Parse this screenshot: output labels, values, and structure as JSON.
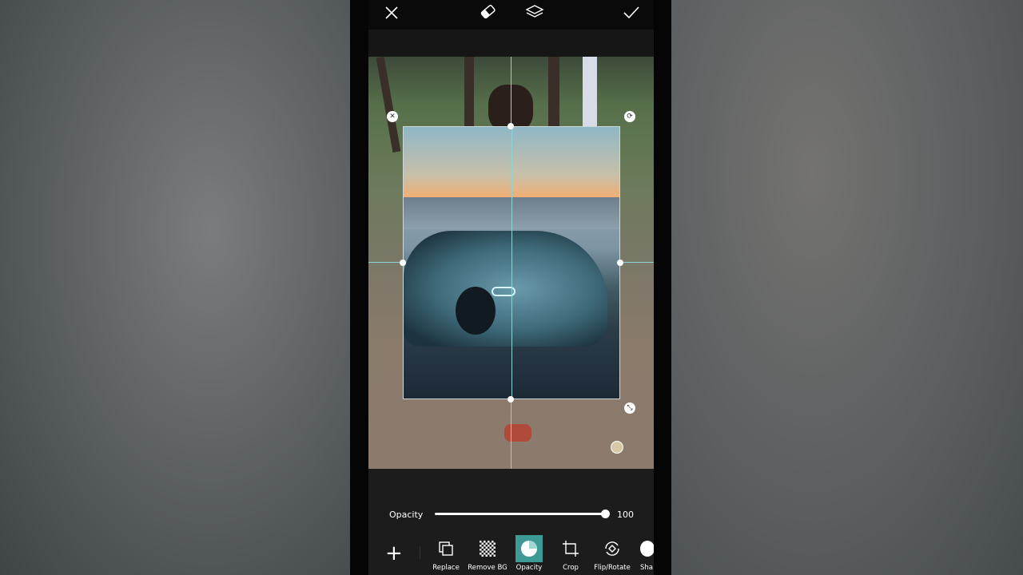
{
  "toolbar": {
    "close": "close-icon",
    "eraser": "eraser-icon",
    "layers": "layers-icon",
    "apply": "check-icon"
  },
  "opacity": {
    "label": "Opacity",
    "value": 100,
    "value_text": "100"
  },
  "tools": [
    {
      "label": "Replace",
      "icon": "replace-icon"
    },
    {
      "label": "Remove BG",
      "icon": "checkerboard-icon"
    },
    {
      "label": "Opacity",
      "icon": "opacity-icon",
      "active": true
    },
    {
      "label": "Crop",
      "icon": "crop-icon"
    },
    {
      "label": "Flip/Rotate",
      "icon": "flip-rotate-icon"
    },
    {
      "label": "Sha",
      "icon": "shadow-icon"
    }
  ],
  "colors": {
    "accent": "#3e9a94",
    "background": "#1c1c1c"
  }
}
